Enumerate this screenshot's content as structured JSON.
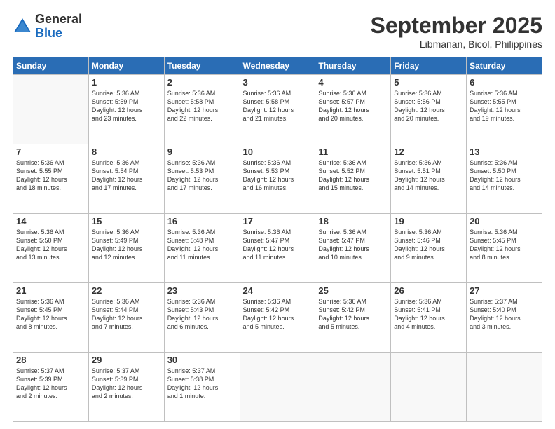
{
  "header": {
    "logo_general": "General",
    "logo_blue": "Blue",
    "month_title": "September 2025",
    "location": "Libmanan, Bicol, Philippines"
  },
  "calendar": {
    "days": [
      "Sunday",
      "Monday",
      "Tuesday",
      "Wednesday",
      "Thursday",
      "Friday",
      "Saturday"
    ],
    "weeks": [
      [
        {
          "day": "",
          "content": ""
        },
        {
          "day": "1",
          "content": "Sunrise: 5:36 AM\nSunset: 5:59 PM\nDaylight: 12 hours\nand 23 minutes."
        },
        {
          "day": "2",
          "content": "Sunrise: 5:36 AM\nSunset: 5:58 PM\nDaylight: 12 hours\nand 22 minutes."
        },
        {
          "day": "3",
          "content": "Sunrise: 5:36 AM\nSunset: 5:58 PM\nDaylight: 12 hours\nand 21 minutes."
        },
        {
          "day": "4",
          "content": "Sunrise: 5:36 AM\nSunset: 5:57 PM\nDaylight: 12 hours\nand 20 minutes."
        },
        {
          "day": "5",
          "content": "Sunrise: 5:36 AM\nSunset: 5:56 PM\nDaylight: 12 hours\nand 20 minutes."
        },
        {
          "day": "6",
          "content": "Sunrise: 5:36 AM\nSunset: 5:55 PM\nDaylight: 12 hours\nand 19 minutes."
        }
      ],
      [
        {
          "day": "7",
          "content": "Sunrise: 5:36 AM\nSunset: 5:55 PM\nDaylight: 12 hours\nand 18 minutes."
        },
        {
          "day": "8",
          "content": "Sunrise: 5:36 AM\nSunset: 5:54 PM\nDaylight: 12 hours\nand 17 minutes."
        },
        {
          "day": "9",
          "content": "Sunrise: 5:36 AM\nSunset: 5:53 PM\nDaylight: 12 hours\nand 17 minutes."
        },
        {
          "day": "10",
          "content": "Sunrise: 5:36 AM\nSunset: 5:53 PM\nDaylight: 12 hours\nand 16 minutes."
        },
        {
          "day": "11",
          "content": "Sunrise: 5:36 AM\nSunset: 5:52 PM\nDaylight: 12 hours\nand 15 minutes."
        },
        {
          "day": "12",
          "content": "Sunrise: 5:36 AM\nSunset: 5:51 PM\nDaylight: 12 hours\nand 14 minutes."
        },
        {
          "day": "13",
          "content": "Sunrise: 5:36 AM\nSunset: 5:50 PM\nDaylight: 12 hours\nand 14 minutes."
        }
      ],
      [
        {
          "day": "14",
          "content": "Sunrise: 5:36 AM\nSunset: 5:50 PM\nDaylight: 12 hours\nand 13 minutes."
        },
        {
          "day": "15",
          "content": "Sunrise: 5:36 AM\nSunset: 5:49 PM\nDaylight: 12 hours\nand 12 minutes."
        },
        {
          "day": "16",
          "content": "Sunrise: 5:36 AM\nSunset: 5:48 PM\nDaylight: 12 hours\nand 11 minutes."
        },
        {
          "day": "17",
          "content": "Sunrise: 5:36 AM\nSunset: 5:47 PM\nDaylight: 12 hours\nand 11 minutes."
        },
        {
          "day": "18",
          "content": "Sunrise: 5:36 AM\nSunset: 5:47 PM\nDaylight: 12 hours\nand 10 minutes."
        },
        {
          "day": "19",
          "content": "Sunrise: 5:36 AM\nSunset: 5:46 PM\nDaylight: 12 hours\nand 9 minutes."
        },
        {
          "day": "20",
          "content": "Sunrise: 5:36 AM\nSunset: 5:45 PM\nDaylight: 12 hours\nand 8 minutes."
        }
      ],
      [
        {
          "day": "21",
          "content": "Sunrise: 5:36 AM\nSunset: 5:45 PM\nDaylight: 12 hours\nand 8 minutes."
        },
        {
          "day": "22",
          "content": "Sunrise: 5:36 AM\nSunset: 5:44 PM\nDaylight: 12 hours\nand 7 minutes."
        },
        {
          "day": "23",
          "content": "Sunrise: 5:36 AM\nSunset: 5:43 PM\nDaylight: 12 hours\nand 6 minutes."
        },
        {
          "day": "24",
          "content": "Sunrise: 5:36 AM\nSunset: 5:42 PM\nDaylight: 12 hours\nand 5 minutes."
        },
        {
          "day": "25",
          "content": "Sunrise: 5:36 AM\nSunset: 5:42 PM\nDaylight: 12 hours\nand 5 minutes."
        },
        {
          "day": "26",
          "content": "Sunrise: 5:36 AM\nSunset: 5:41 PM\nDaylight: 12 hours\nand 4 minutes."
        },
        {
          "day": "27",
          "content": "Sunrise: 5:37 AM\nSunset: 5:40 PM\nDaylight: 12 hours\nand 3 minutes."
        }
      ],
      [
        {
          "day": "28",
          "content": "Sunrise: 5:37 AM\nSunset: 5:39 PM\nDaylight: 12 hours\nand 2 minutes."
        },
        {
          "day": "29",
          "content": "Sunrise: 5:37 AM\nSunset: 5:39 PM\nDaylight: 12 hours\nand 2 minutes."
        },
        {
          "day": "30",
          "content": "Sunrise: 5:37 AM\nSunset: 5:38 PM\nDaylight: 12 hours\nand 1 minute."
        },
        {
          "day": "",
          "content": ""
        },
        {
          "day": "",
          "content": ""
        },
        {
          "day": "",
          "content": ""
        },
        {
          "day": "",
          "content": ""
        }
      ]
    ]
  }
}
